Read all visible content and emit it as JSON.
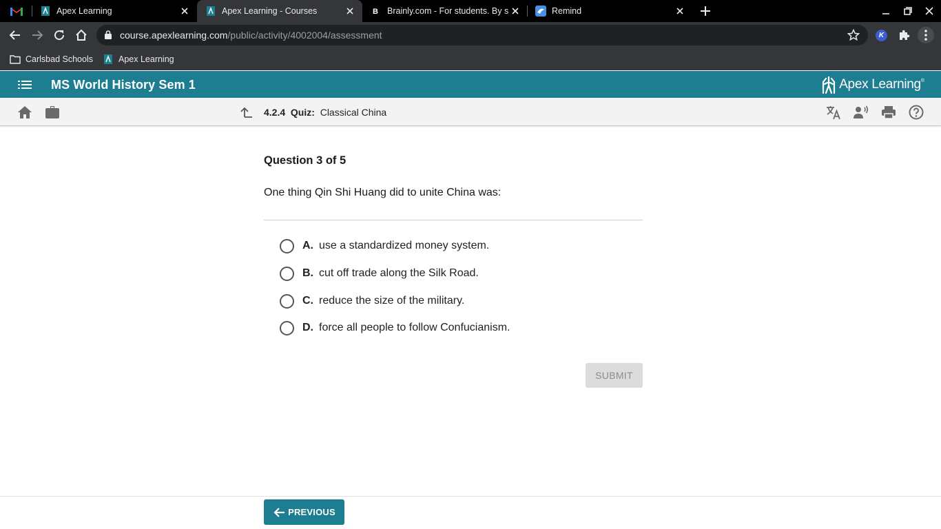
{
  "browser": {
    "tabs": [
      {
        "title": "Apex Learning",
        "active": false
      },
      {
        "title": "Apex Learning - Courses",
        "active": true
      },
      {
        "title": "Brainly.com - For students. By st",
        "active": false
      },
      {
        "title": "Remind",
        "active": false
      }
    ],
    "url": {
      "host": "course.apexlearning.com",
      "path": "/public/activity/4002004/assessment"
    },
    "bookmarks": [
      {
        "label": "Carlsbad Schools"
      },
      {
        "label": "Apex Learning"
      }
    ],
    "extension_badge": "K"
  },
  "app": {
    "course_title": "MS World History Sem 1",
    "logo_text": "Apex Learning",
    "logo_tm": "®"
  },
  "breadcrumb": {
    "number": "4.2.4",
    "type": "Quiz:",
    "name": "Classical China"
  },
  "quiz": {
    "progress": "Question 3 of 5",
    "question": "One thing Qin Shi Huang did to unite China was:",
    "options": [
      {
        "letter": "A.",
        "text": "use a standardized money system."
      },
      {
        "letter": "B.",
        "text": "cut off trade along the Silk Road."
      },
      {
        "letter": "C.",
        "text": "reduce the size of the military."
      },
      {
        "letter": "D.",
        "text": "force all people to follow Confucianism."
      }
    ],
    "submit_label": "SUBMIT",
    "previous_label": "PREVIOUS"
  },
  "colors": {
    "brand_teal": "#1d7e91",
    "chrome_dark": "#35363a",
    "tabstrip": "#000000"
  }
}
